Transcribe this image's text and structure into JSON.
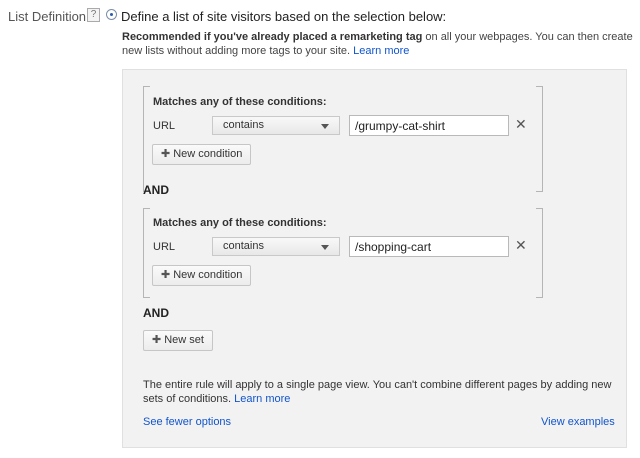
{
  "list_definition": {
    "label": "List Definition",
    "help_icon": "?",
    "radio_label": "Define a list of site visitors based on the selection below:"
  },
  "recommendation": {
    "bold": "Recommended if you've already placed a remarketing tag",
    "rest": " on all your webpages. You can then create new lists without adding more tags to your site.",
    "learn_more": "Learn more"
  },
  "sets": [
    {
      "title": "Matches any of these conditions:",
      "field": "URL",
      "operator": "contains",
      "value": "/grumpy-cat-shirt",
      "new_condition": "New condition"
    },
    {
      "title": "Matches any of these conditions:",
      "field": "URL",
      "operator": "contains",
      "value": "/shopping-cart",
      "new_condition": "New condition"
    }
  ],
  "and_label": "AND",
  "new_set": "New set",
  "note": {
    "text": "The entire rule will apply to a single page view. You can't combine different pages by adding new sets of conditions.",
    "learn_more": "Learn more"
  },
  "links": {
    "see_fewer": "See fewer options",
    "view_examples": "View examples"
  },
  "icons": {
    "remove": "close-icon",
    "plus": "plus-icon",
    "dropdown": "chevron-down-icon"
  }
}
